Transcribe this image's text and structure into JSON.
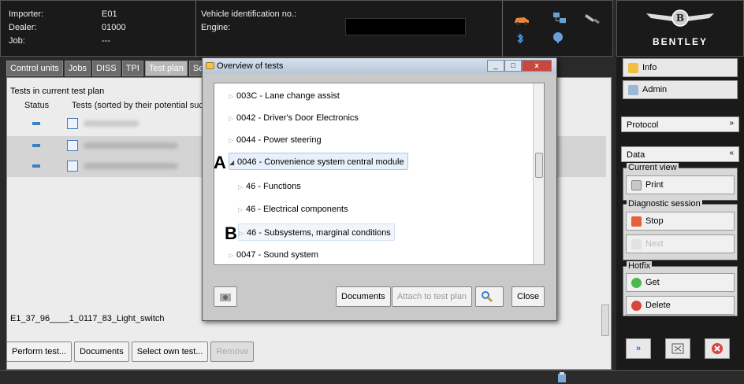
{
  "header": {
    "importer_label": "Importer:",
    "importer_value": "E01",
    "dealer_label": "Dealer:",
    "dealer_value": "01000",
    "job_label": "Job:",
    "job_value": "---",
    "vin_label": "Vehicle identification no.:",
    "engine_label": "Engine:"
  },
  "logo": {
    "brand": "BENTLEY"
  },
  "tabs": [
    "Control units",
    "Jobs",
    "DISS",
    "TPI",
    "Test plan",
    "Seque"
  ],
  "panel": {
    "title": "Tests in current test plan",
    "col_status": "Status",
    "col_tests": "Tests (sorted by their potential suc",
    "status_line": "E1_37_96____1_0117_83_Light_switch"
  },
  "bottom_buttons": {
    "perform": "Perform test...",
    "documents": "Documents",
    "select_own": "Select own test...",
    "remove": "Remove"
  },
  "right": {
    "info": "Info",
    "admin": "Admin",
    "protocol": "Protocol",
    "data": "Data",
    "current_view": "Current view",
    "print": "Print",
    "diag_session": "Diagnostic session",
    "stop": "Stop",
    "next": "Next",
    "hotfix": "Hotfix",
    "get": "Get",
    "delete": "Delete"
  },
  "dialog": {
    "title": "Overview of tests",
    "items": [
      "003C - Lane change assist",
      "0042 - Driver's Door Electronics",
      "0044 - Power steering",
      "0046 - Convenience system central module",
      "46 - Functions",
      "46 - Electrical components",
      "46 - Subsystems, marginal conditions",
      "0047 - Sound system"
    ],
    "marker_a": "A",
    "marker_b": "B",
    "btn_documents": "Documents",
    "btn_attach": "Attach to test plan",
    "btn_close": "Close"
  }
}
